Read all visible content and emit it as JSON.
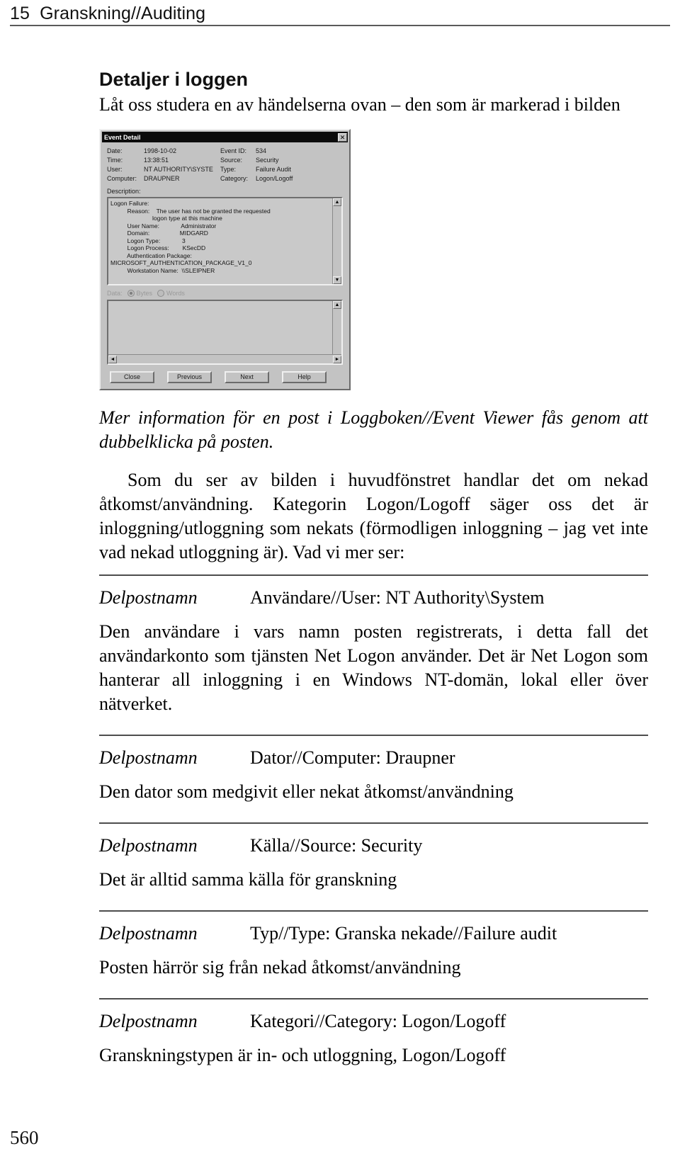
{
  "running_head": {
    "chapter_number": "15",
    "title": "Granskning//Auditing"
  },
  "section": {
    "heading": "Detaljer i loggen",
    "lead": "Låt oss studera en av händelserna ovan – den som är markerad i bilden"
  },
  "dialog": {
    "title": "Event Detail",
    "close_label": "✕",
    "fields": {
      "date_label": "Date:",
      "date_value": "1998-10-02",
      "time_label": "Time:",
      "time_value": "13:38:51",
      "user_label": "User:",
      "user_value": "NT AUTHORITY\\SYSTE",
      "computer_label": "Computer:",
      "computer_value": "DRAUPNER",
      "eventid_label": "Event ID:",
      "eventid_value": "534",
      "source_label": "Source:",
      "source_value": "Security",
      "type_label": "Type:",
      "type_value": "Failure Audit",
      "category_label": "Category:",
      "category_value": "Logon/Logoff"
    },
    "description_label": "Description:",
    "description_text": "Logon Failure:\n          Reason:    The user has not be granted the requested\n                         logon type at this machine\n          User Name:             Administrator\n          Domain:                  MIDGARD\n          Logon Type:             3\n          Logon Process:        KSecDD\n          Authentication Package:\nMICROSOFT_AUTHENTICATION_PACKAGE_V1_0\n          Workstation Name:  \\\\SLEIPNER",
    "data_label": "Data:",
    "radio_bytes": "Bytes",
    "radio_words": "Words",
    "data_text": "",
    "buttons": [
      "Close",
      "Previous",
      "Next",
      "Help"
    ],
    "scroll_up": "▲",
    "scroll_down": "▼",
    "scroll_left": "◄",
    "scroll_right": "►"
  },
  "caption": "Mer information för en post i Loggboken//Event Viewer fås genom att dubbelklicka på posten.",
  "paragraph_main": "Som du ser av bilden i huvudfönstret handlar det om nekad åtkomst/användning. Kategorin Logon/Logoff säger oss det är inloggning/utloggning som nekats (förmodligen inloggning – jag vet inte vad nekad utloggning är). Vad vi mer ser:",
  "entries": [
    {
      "term": "Delpostnamn",
      "value": "Användare//User: NT Authority\\System",
      "description": "Den användare i vars namn posten registrerats, i detta fall det användarkonto som tjänsten Net Logon använder. Det är Net Logon som hanterar all inloggning i en Windows NT-domän, lokal eller över nätverket."
    },
    {
      "term": "Delpostnamn",
      "value": "Dator//Computer: Draupner",
      "description": "Den dator som medgivit eller nekat åtkomst/användning"
    },
    {
      "term": "Delpostnamn",
      "value": "Källa//Source: Security",
      "description": "Det är alltid samma källa för granskning"
    },
    {
      "term": "Delpostnamn",
      "value": "Typ//Type: Granska nekade//Failure audit",
      "description": "Posten härrör sig från nekad åtkomst/användning"
    },
    {
      "term": "Delpostnamn",
      "value": "Kategori//Category: Logon/Logoff",
      "description": "Granskningstypen är in- och utloggning, Logon/Logoff"
    }
  ],
  "folio": "560"
}
